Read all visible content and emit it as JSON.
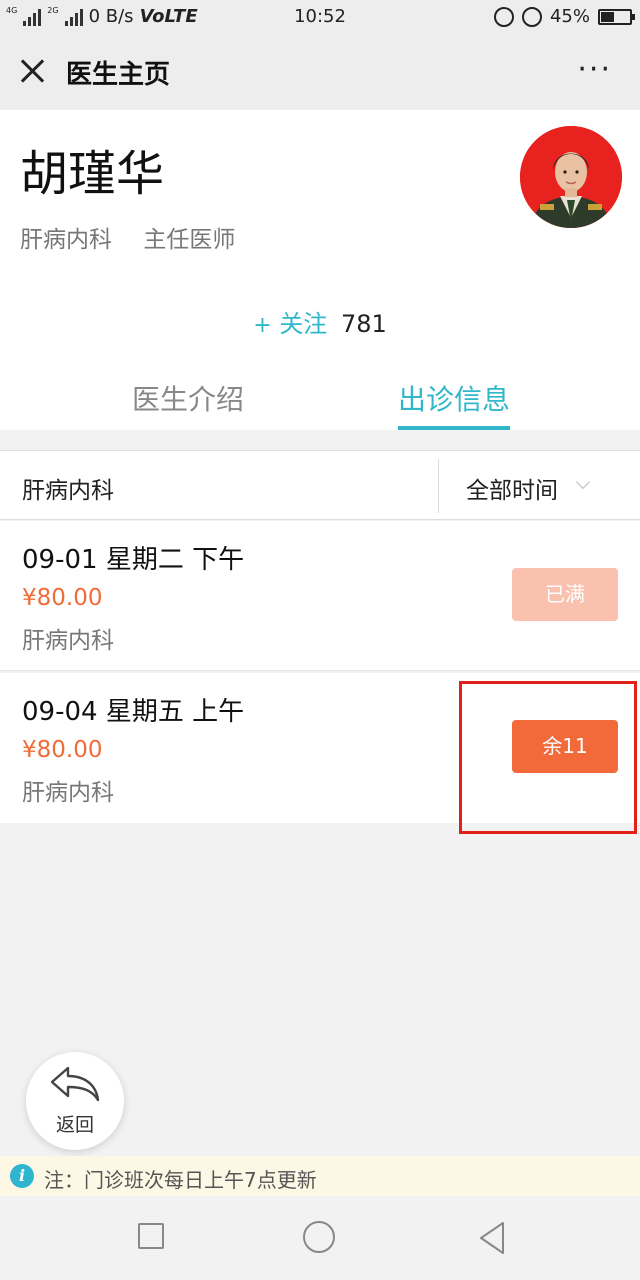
{
  "status_bar": {
    "net_gen1": "4G",
    "net_gen2": "2G",
    "speed": "0 B/s",
    "volte": "VoLTE",
    "time": "10:52",
    "battery": "45%",
    "battery_level": 0.45
  },
  "nav": {
    "title": "医生主页",
    "more": "···"
  },
  "doctor": {
    "name": "胡瑾华",
    "department": "肝病内科",
    "title": "主任医师",
    "follow_plus": "+",
    "follow_label": "关注",
    "follow_count": "781"
  },
  "tabs": [
    {
      "label": "医生介绍",
      "active": false
    },
    {
      "label": "出诊信息",
      "active": true
    }
  ],
  "filter": {
    "department": "肝病内科",
    "time": "全部时间"
  },
  "slots": [
    {
      "date": "09-01 星期二 下午",
      "price": "¥80.00",
      "department": "肝病内科",
      "button": "已满",
      "status": "full"
    },
    {
      "date": "09-04 星期五 上午",
      "price": "¥80.00",
      "department": "肝病内科",
      "button": "余11",
      "status": "available"
    }
  ],
  "back_button": {
    "label": "返回"
  },
  "notice": {
    "icon": "i",
    "text": "注：门诊班次每日上午7点更新"
  },
  "colors": {
    "accent": "#30b7c9",
    "price": "#f26b3a",
    "button_available": "#f2693a",
    "button_full": "#f9c1ae",
    "highlight": "#e1201a"
  }
}
